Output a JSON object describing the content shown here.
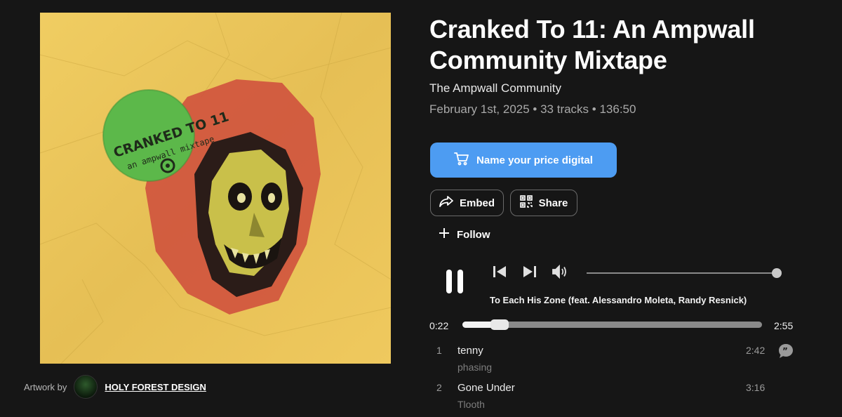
{
  "album": {
    "title": "Cranked To 11: An Ampwall Community Mixtape",
    "artist": "The Ampwall Community",
    "meta": "February 1st, 2025 • 33 tracks • 136:50"
  },
  "artwork": {
    "sticker_line1": "CRANKED TO 11",
    "sticker_line2": "an ampwall mixtape",
    "colors": {
      "background": "#e8c35a",
      "hood": "#d0553e",
      "sticker": "#5cb84a",
      "skull": "#c9c04a"
    }
  },
  "credit": {
    "prefix": "Artwork by",
    "artist_link": "HOLY FOREST DESIGN"
  },
  "actions": {
    "buy_label": "Name your price digital",
    "embed_label": "Embed",
    "share_label": "Share",
    "follow_label": "Follow"
  },
  "player": {
    "now_playing": "To Each His Zone (feat. Alessandro Moleta, Randy Resnick)",
    "current_time": "0:22",
    "total_time": "2:55",
    "progress_fraction": 0.125,
    "volume_fraction": 1.0
  },
  "tracks": [
    {
      "num": "1",
      "title": "tenny",
      "artist": "phasing",
      "duration": "2:42"
    },
    {
      "num": "2",
      "title": "Gone Under",
      "artist": "Tlooth",
      "duration": "3:16"
    }
  ],
  "colors": {
    "accent": "#4d9cf2",
    "background": "#161616"
  },
  "icons": [
    "cart-icon",
    "embed-share-arrow-icon",
    "qr-code-icon",
    "plus-icon",
    "pause-icon",
    "previous-icon",
    "next-icon",
    "volume-icon",
    "comment-icon"
  ]
}
